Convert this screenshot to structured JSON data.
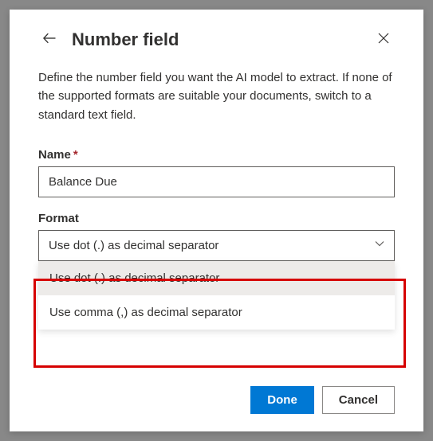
{
  "header": {
    "title": "Number field"
  },
  "description": "Define the number field you want the AI model to extract. If none of the supported formats are suitable your documents, switch to a standard text field.",
  "name_field": {
    "label": "Name",
    "required_mark": "*",
    "value": "Balance Due"
  },
  "format_field": {
    "label": "Format",
    "selected": "Use dot (.) as decimal separator",
    "options": [
      {
        "label": "Use dot (.) as decimal separator",
        "selected": true
      },
      {
        "label": "Use comma (,) as decimal separator",
        "selected": false
      }
    ]
  },
  "footer": {
    "done_label": "Done",
    "cancel_label": "Cancel"
  }
}
